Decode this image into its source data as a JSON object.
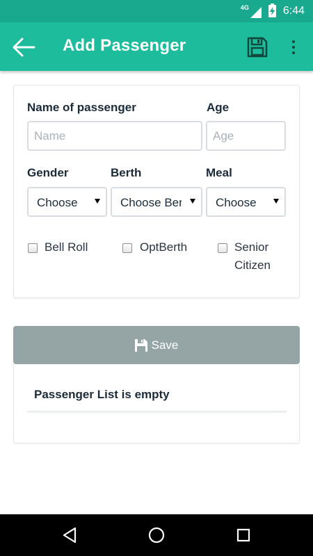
{
  "status_bar": {
    "network": "4G",
    "time": "6:44"
  },
  "app_bar": {
    "title": "Add Passenger",
    "back_icon": "arrow-left-icon",
    "save_icon": "floppy-disk-icon",
    "more_icon": "more-vert-icon"
  },
  "form": {
    "name_label": "Name of passenger",
    "name_placeholder": "Name",
    "name_value": "",
    "age_label": "Age",
    "age_placeholder": "Age",
    "age_value": "",
    "gender_label": "Gender",
    "gender_selected": "Choose",
    "berth_label": "Berth",
    "berth_selected": "Choose Berth",
    "meal_label": "Meal",
    "meal_selected": "Choose",
    "checkboxes": [
      {
        "label": "Bell Roll",
        "checked": false
      },
      {
        "label": "OptBerth",
        "checked": false
      },
      {
        "label_line1": "Senior",
        "label_line2": "Citizen",
        "checked": false
      }
    ]
  },
  "save_button": {
    "label": "Save",
    "icon": "floppy-disk-icon"
  },
  "passenger_list": {
    "empty_text": "Passenger List is empty"
  },
  "colors": {
    "status_bar": "#19a98f",
    "app_bar": "#1cbc9c",
    "save_button": "#95a5a6",
    "heading_text": "#1c2b3a"
  },
  "nav_bar": {
    "back_icon": "nav-back-icon",
    "home_icon": "nav-home-icon",
    "recents_icon": "nav-recents-icon"
  }
}
